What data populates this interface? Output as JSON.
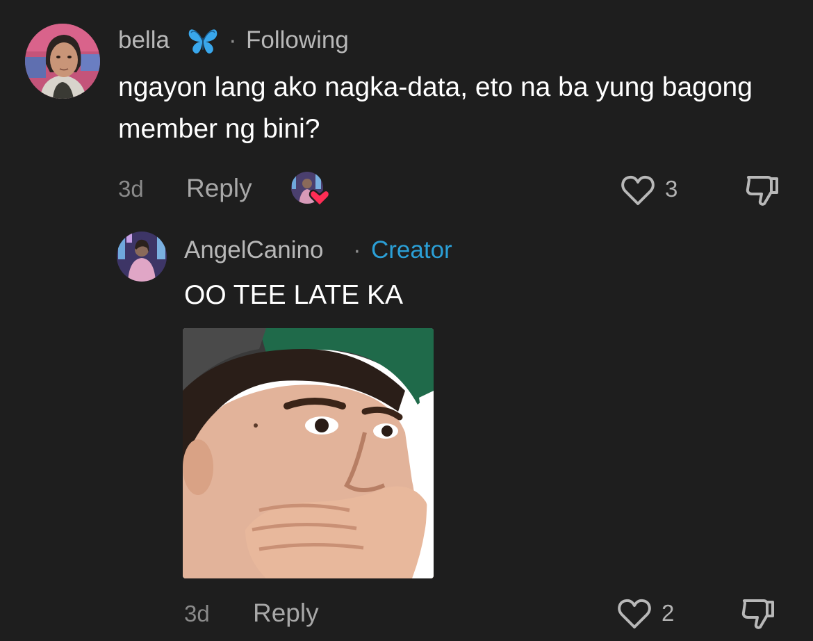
{
  "comment": {
    "username": "bella",
    "separator": "·",
    "following_label": "Following",
    "text": "ngayon lang ako nagka-data, eto na ba yung bagong member ng bini?",
    "time": "3d",
    "reply_label": "Reply",
    "like_count": "3",
    "icons": {
      "badge": "butterfly-emoji-icon",
      "liked_by_creator": "creator-liked-heart-icon",
      "like": "heart-outline-icon",
      "dislike": "thumbs-down-icon"
    }
  },
  "reply": {
    "username": "AngelCanino",
    "separator": "·",
    "creator_label": "Creator",
    "text": "OO TEE LATE KA",
    "time": "3d",
    "reply_label": "Reply",
    "like_count": "2",
    "sticker_icon": "reaction-sticker-face-covering-mouth",
    "icons": {
      "like": "heart-outline-icon",
      "dislike": "thumbs-down-icon"
    }
  },
  "colors": {
    "background": "#1e1e1e",
    "creator_accent": "#2b9fd6",
    "like_heart": "#ff2d55",
    "butterfly": "#39a7ec"
  }
}
